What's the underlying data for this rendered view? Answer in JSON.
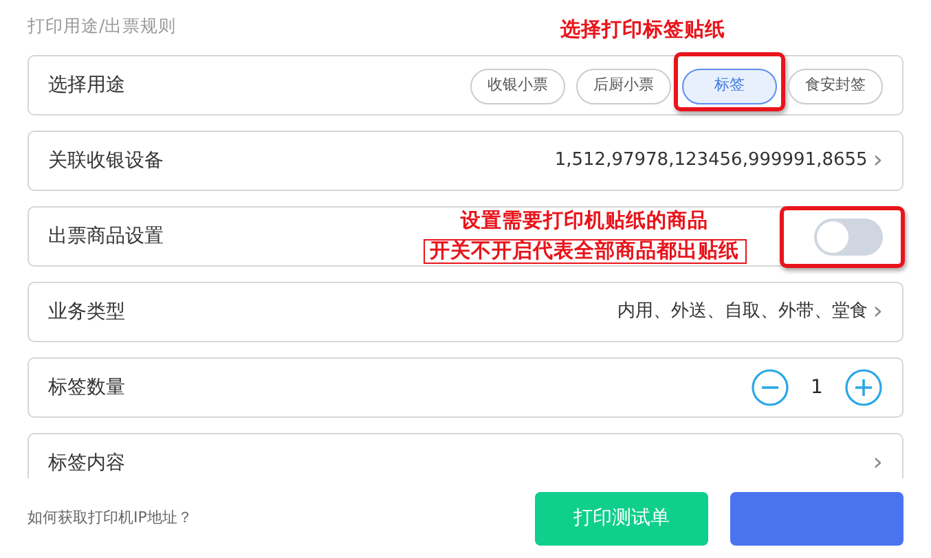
{
  "section_title": "打印用途/出票规则",
  "rows": [
    {
      "kind": "options",
      "label": "选择用途",
      "options": [
        {
          "label": "收银小票",
          "selected": false,
          "highlighted": false
        },
        {
          "label": "后厨小票",
          "selected": false,
          "highlighted": false
        },
        {
          "label": "标签",
          "selected": true,
          "highlighted": true
        },
        {
          "label": "食安封签",
          "selected": false,
          "highlighted": false
        }
      ]
    },
    {
      "kind": "value",
      "label": "关联收银设备",
      "value": "1,512,97978,123456,999991,8655",
      "chevron": "›"
    },
    {
      "kind": "toggle",
      "label": "出票商品设置",
      "on": false,
      "highlighted": true
    },
    {
      "kind": "value",
      "label": "业务类型",
      "value": "内用、外送、自取、外带、堂食",
      "chevron": "›"
    },
    {
      "kind": "stepper",
      "label": "标签数量",
      "value": "1"
    },
    {
      "kind": "value",
      "label": "标签内容",
      "chevron": "›"
    }
  ],
  "annotations": [
    {
      "lines": [
        {
          "text": "选择打印标签贴纸",
          "boxed": false
        }
      ]
    },
    {
      "lines": [
        {
          "text": "设置需要打印机贴纸的商品",
          "boxed": false
        },
        {
          "text": "开关不开启代表全部商品都出贴纸",
          "boxed": true
        }
      ]
    }
  ],
  "footer": {
    "help_link": "如何获取打印机IP地址？",
    "buttons": [
      {
        "label": "打印测试单",
        "kind": "test"
      },
      {
        "kind": "primary"
      }
    ]
  }
}
